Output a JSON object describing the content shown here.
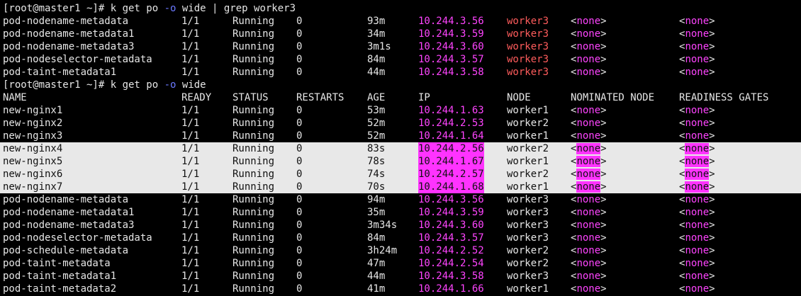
{
  "commands": [
    {
      "prompt": "[root@master1 ~]# ",
      "pre": "k get po ",
      "flag": "-o",
      "post": " wide | grep worker3"
    },
    {
      "prompt": "[root@master1 ~]# ",
      "pre": "k get po ",
      "flag": "-o",
      "post": " wide"
    }
  ],
  "headers": [
    "NAME",
    "READY",
    "STATUS",
    "RESTARTS",
    "AGE",
    "IP",
    "NODE",
    "NOMINATED NODE",
    "READINESS GATES"
  ],
  "first_output": [
    {
      "name": "pod-nodename-metadata",
      "ready": "1/1",
      "status": "Running",
      "restarts": "0",
      "age": "93m",
      "ip": "10.244.3.56",
      "node": "worker3",
      "nominated": "none",
      "gates": "none"
    },
    {
      "name": "pod-nodename-metadata1",
      "ready": "1/1",
      "status": "Running",
      "restarts": "0",
      "age": "34m",
      "ip": "10.244.3.59",
      "node": "worker3",
      "nominated": "none",
      "gates": "none"
    },
    {
      "name": "pod-nodename-metadata3",
      "ready": "1/1",
      "status": "Running",
      "restarts": "0",
      "age": "3m1s",
      "ip": "10.244.3.60",
      "node": "worker3",
      "nominated": "none",
      "gates": "none"
    },
    {
      "name": "pod-nodeselector-metadata",
      "ready": "1/1",
      "status": "Running",
      "restarts": "0",
      "age": "84m",
      "ip": "10.244.3.57",
      "node": "worker3",
      "nominated": "none",
      "gates": "none"
    },
    {
      "name": "pod-taint-metadata1",
      "ready": "1/1",
      "status": "Running",
      "restarts": "0",
      "age": "44m",
      "ip": "10.244.3.58",
      "node": "worker3",
      "nominated": "none",
      "gates": "none"
    }
  ],
  "second_output": [
    {
      "name": "new-nginx1",
      "ready": "1/1",
      "status": "Running",
      "restarts": "0",
      "age": "53m",
      "ip": "10.244.1.63",
      "node": "worker1",
      "nominated": "none",
      "gates": "none",
      "selected": false
    },
    {
      "name": "new-nginx2",
      "ready": "1/1",
      "status": "Running",
      "restarts": "0",
      "age": "52m",
      "ip": "10.244.2.53",
      "node": "worker2",
      "nominated": "none",
      "gates": "none",
      "selected": false
    },
    {
      "name": "new-nginx3",
      "ready": "1/1",
      "status": "Running",
      "restarts": "0",
      "age": "52m",
      "ip": "10.244.1.64",
      "node": "worker1",
      "nominated": "none",
      "gates": "none",
      "selected": false
    },
    {
      "name": "new-nginx4",
      "ready": "1/1",
      "status": "Running",
      "restarts": "0",
      "age": "83s",
      "ip": "10.244.2.56",
      "node": "worker2",
      "nominated": "none",
      "gates": "none",
      "selected": true
    },
    {
      "name": "new-nginx5",
      "ready": "1/1",
      "status": "Running",
      "restarts": "0",
      "age": "78s",
      "ip": "10.244.1.67",
      "node": "worker1",
      "nominated": "none",
      "gates": "none",
      "selected": true
    },
    {
      "name": "new-nginx6",
      "ready": "1/1",
      "status": "Running",
      "restarts": "0",
      "age": "74s",
      "ip": "10.244.2.57",
      "node": "worker2",
      "nominated": "none",
      "gates": "none",
      "selected": true
    },
    {
      "name": "new-nginx7",
      "ready": "1/1",
      "status": "Running",
      "restarts": "0",
      "age": "70s",
      "ip": "10.244.1.68",
      "node": "worker1",
      "nominated": "none",
      "gates": "none",
      "selected": true
    },
    {
      "name": "pod-nodename-metadata",
      "ready": "1/1",
      "status": "Running",
      "restarts": "0",
      "age": "94m",
      "ip": "10.244.3.56",
      "node": "worker3",
      "nominated": "none",
      "gates": "none",
      "selected": false
    },
    {
      "name": "pod-nodename-metadata1",
      "ready": "1/1",
      "status": "Running",
      "restarts": "0",
      "age": "35m",
      "ip": "10.244.3.59",
      "node": "worker3",
      "nominated": "none",
      "gates": "none",
      "selected": false
    },
    {
      "name": "pod-nodename-metadata3",
      "ready": "1/1",
      "status": "Running",
      "restarts": "0",
      "age": "3m34s",
      "ip": "10.244.3.60",
      "node": "worker3",
      "nominated": "none",
      "gates": "none",
      "selected": false
    },
    {
      "name": "pod-nodeselector-metadata",
      "ready": "1/1",
      "status": "Running",
      "restarts": "0",
      "age": "84m",
      "ip": "10.244.3.57",
      "node": "worker3",
      "nominated": "none",
      "gates": "none",
      "selected": false
    },
    {
      "name": "pod-schedule-metadata",
      "ready": "1/1",
      "status": "Running",
      "restarts": "0",
      "age": "3h24m",
      "ip": "10.244.2.52",
      "node": "worker2",
      "nominated": "none",
      "gates": "none",
      "selected": false
    },
    {
      "name": "pod-taint-metadata",
      "ready": "1/1",
      "status": "Running",
      "restarts": "0",
      "age": "47m",
      "ip": "10.244.2.54",
      "node": "worker2",
      "nominated": "none",
      "gates": "none",
      "selected": false
    },
    {
      "name": "pod-taint-metadata1",
      "ready": "1/1",
      "status": "Running",
      "restarts": "0",
      "age": "44m",
      "ip": "10.244.3.58",
      "node": "worker3",
      "nominated": "none",
      "gates": "none",
      "selected": false
    },
    {
      "name": "pod-taint-metadata2",
      "ready": "1/1",
      "status": "Running",
      "restarts": "0",
      "age": "41m",
      "ip": "10.244.1.66",
      "node": "worker1",
      "nominated": "none",
      "gates": "none",
      "selected": false
    }
  ],
  "colors": {
    "background": "#000000",
    "text": "#e6e6e6",
    "ip": "#ff44ff",
    "grep_match": "#ff5c5c",
    "flag": "#6b79ff",
    "selection": "#e8e8e8"
  }
}
